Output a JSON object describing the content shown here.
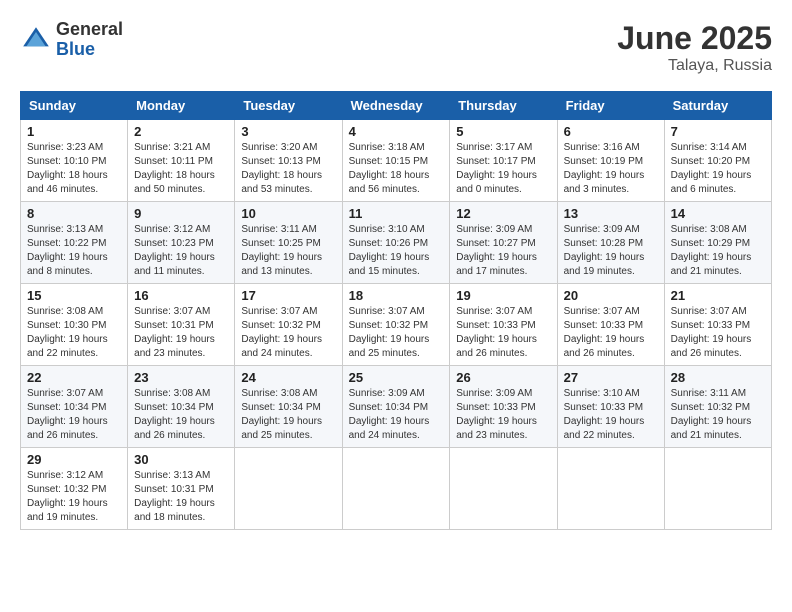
{
  "logo": {
    "general": "General",
    "blue": "Blue"
  },
  "title": "June 2025",
  "location": "Talaya, Russia",
  "days_of_week": [
    "Sunday",
    "Monday",
    "Tuesday",
    "Wednesday",
    "Thursday",
    "Friday",
    "Saturday"
  ],
  "weeks": [
    [
      {
        "day": "1",
        "info": "Sunrise: 3:23 AM\nSunset: 10:10 PM\nDaylight: 18 hours\nand 46 minutes."
      },
      {
        "day": "2",
        "info": "Sunrise: 3:21 AM\nSunset: 10:11 PM\nDaylight: 18 hours\nand 50 minutes."
      },
      {
        "day": "3",
        "info": "Sunrise: 3:20 AM\nSunset: 10:13 PM\nDaylight: 18 hours\nand 53 minutes."
      },
      {
        "day": "4",
        "info": "Sunrise: 3:18 AM\nSunset: 10:15 PM\nDaylight: 18 hours\nand 56 minutes."
      },
      {
        "day": "5",
        "info": "Sunrise: 3:17 AM\nSunset: 10:17 PM\nDaylight: 19 hours\nand 0 minutes."
      },
      {
        "day": "6",
        "info": "Sunrise: 3:16 AM\nSunset: 10:19 PM\nDaylight: 19 hours\nand 3 minutes."
      },
      {
        "day": "7",
        "info": "Sunrise: 3:14 AM\nSunset: 10:20 PM\nDaylight: 19 hours\nand 6 minutes."
      }
    ],
    [
      {
        "day": "8",
        "info": "Sunrise: 3:13 AM\nSunset: 10:22 PM\nDaylight: 19 hours\nand 8 minutes."
      },
      {
        "day": "9",
        "info": "Sunrise: 3:12 AM\nSunset: 10:23 PM\nDaylight: 19 hours\nand 11 minutes."
      },
      {
        "day": "10",
        "info": "Sunrise: 3:11 AM\nSunset: 10:25 PM\nDaylight: 19 hours\nand 13 minutes."
      },
      {
        "day": "11",
        "info": "Sunrise: 3:10 AM\nSunset: 10:26 PM\nDaylight: 19 hours\nand 15 minutes."
      },
      {
        "day": "12",
        "info": "Sunrise: 3:09 AM\nSunset: 10:27 PM\nDaylight: 19 hours\nand 17 minutes."
      },
      {
        "day": "13",
        "info": "Sunrise: 3:09 AM\nSunset: 10:28 PM\nDaylight: 19 hours\nand 19 minutes."
      },
      {
        "day": "14",
        "info": "Sunrise: 3:08 AM\nSunset: 10:29 PM\nDaylight: 19 hours\nand 21 minutes."
      }
    ],
    [
      {
        "day": "15",
        "info": "Sunrise: 3:08 AM\nSunset: 10:30 PM\nDaylight: 19 hours\nand 22 minutes."
      },
      {
        "day": "16",
        "info": "Sunrise: 3:07 AM\nSunset: 10:31 PM\nDaylight: 19 hours\nand 23 minutes."
      },
      {
        "day": "17",
        "info": "Sunrise: 3:07 AM\nSunset: 10:32 PM\nDaylight: 19 hours\nand 24 minutes."
      },
      {
        "day": "18",
        "info": "Sunrise: 3:07 AM\nSunset: 10:32 PM\nDaylight: 19 hours\nand 25 minutes."
      },
      {
        "day": "19",
        "info": "Sunrise: 3:07 AM\nSunset: 10:33 PM\nDaylight: 19 hours\nand 26 minutes."
      },
      {
        "day": "20",
        "info": "Sunrise: 3:07 AM\nSunset: 10:33 PM\nDaylight: 19 hours\nand 26 minutes."
      },
      {
        "day": "21",
        "info": "Sunrise: 3:07 AM\nSunset: 10:33 PM\nDaylight: 19 hours\nand 26 minutes."
      }
    ],
    [
      {
        "day": "22",
        "info": "Sunrise: 3:07 AM\nSunset: 10:34 PM\nDaylight: 19 hours\nand 26 minutes."
      },
      {
        "day": "23",
        "info": "Sunrise: 3:08 AM\nSunset: 10:34 PM\nDaylight: 19 hours\nand 26 minutes."
      },
      {
        "day": "24",
        "info": "Sunrise: 3:08 AM\nSunset: 10:34 PM\nDaylight: 19 hours\nand 25 minutes."
      },
      {
        "day": "25",
        "info": "Sunrise: 3:09 AM\nSunset: 10:34 PM\nDaylight: 19 hours\nand 24 minutes."
      },
      {
        "day": "26",
        "info": "Sunrise: 3:09 AM\nSunset: 10:33 PM\nDaylight: 19 hours\nand 23 minutes."
      },
      {
        "day": "27",
        "info": "Sunrise: 3:10 AM\nSunset: 10:33 PM\nDaylight: 19 hours\nand 22 minutes."
      },
      {
        "day": "28",
        "info": "Sunrise: 3:11 AM\nSunset: 10:32 PM\nDaylight: 19 hours\nand 21 minutes."
      }
    ],
    [
      {
        "day": "29",
        "info": "Sunrise: 3:12 AM\nSunset: 10:32 PM\nDaylight: 19 hours\nand 19 minutes."
      },
      {
        "day": "30",
        "info": "Sunrise: 3:13 AM\nSunset: 10:31 PM\nDaylight: 19 hours\nand 18 minutes."
      },
      null,
      null,
      null,
      null,
      null
    ]
  ]
}
